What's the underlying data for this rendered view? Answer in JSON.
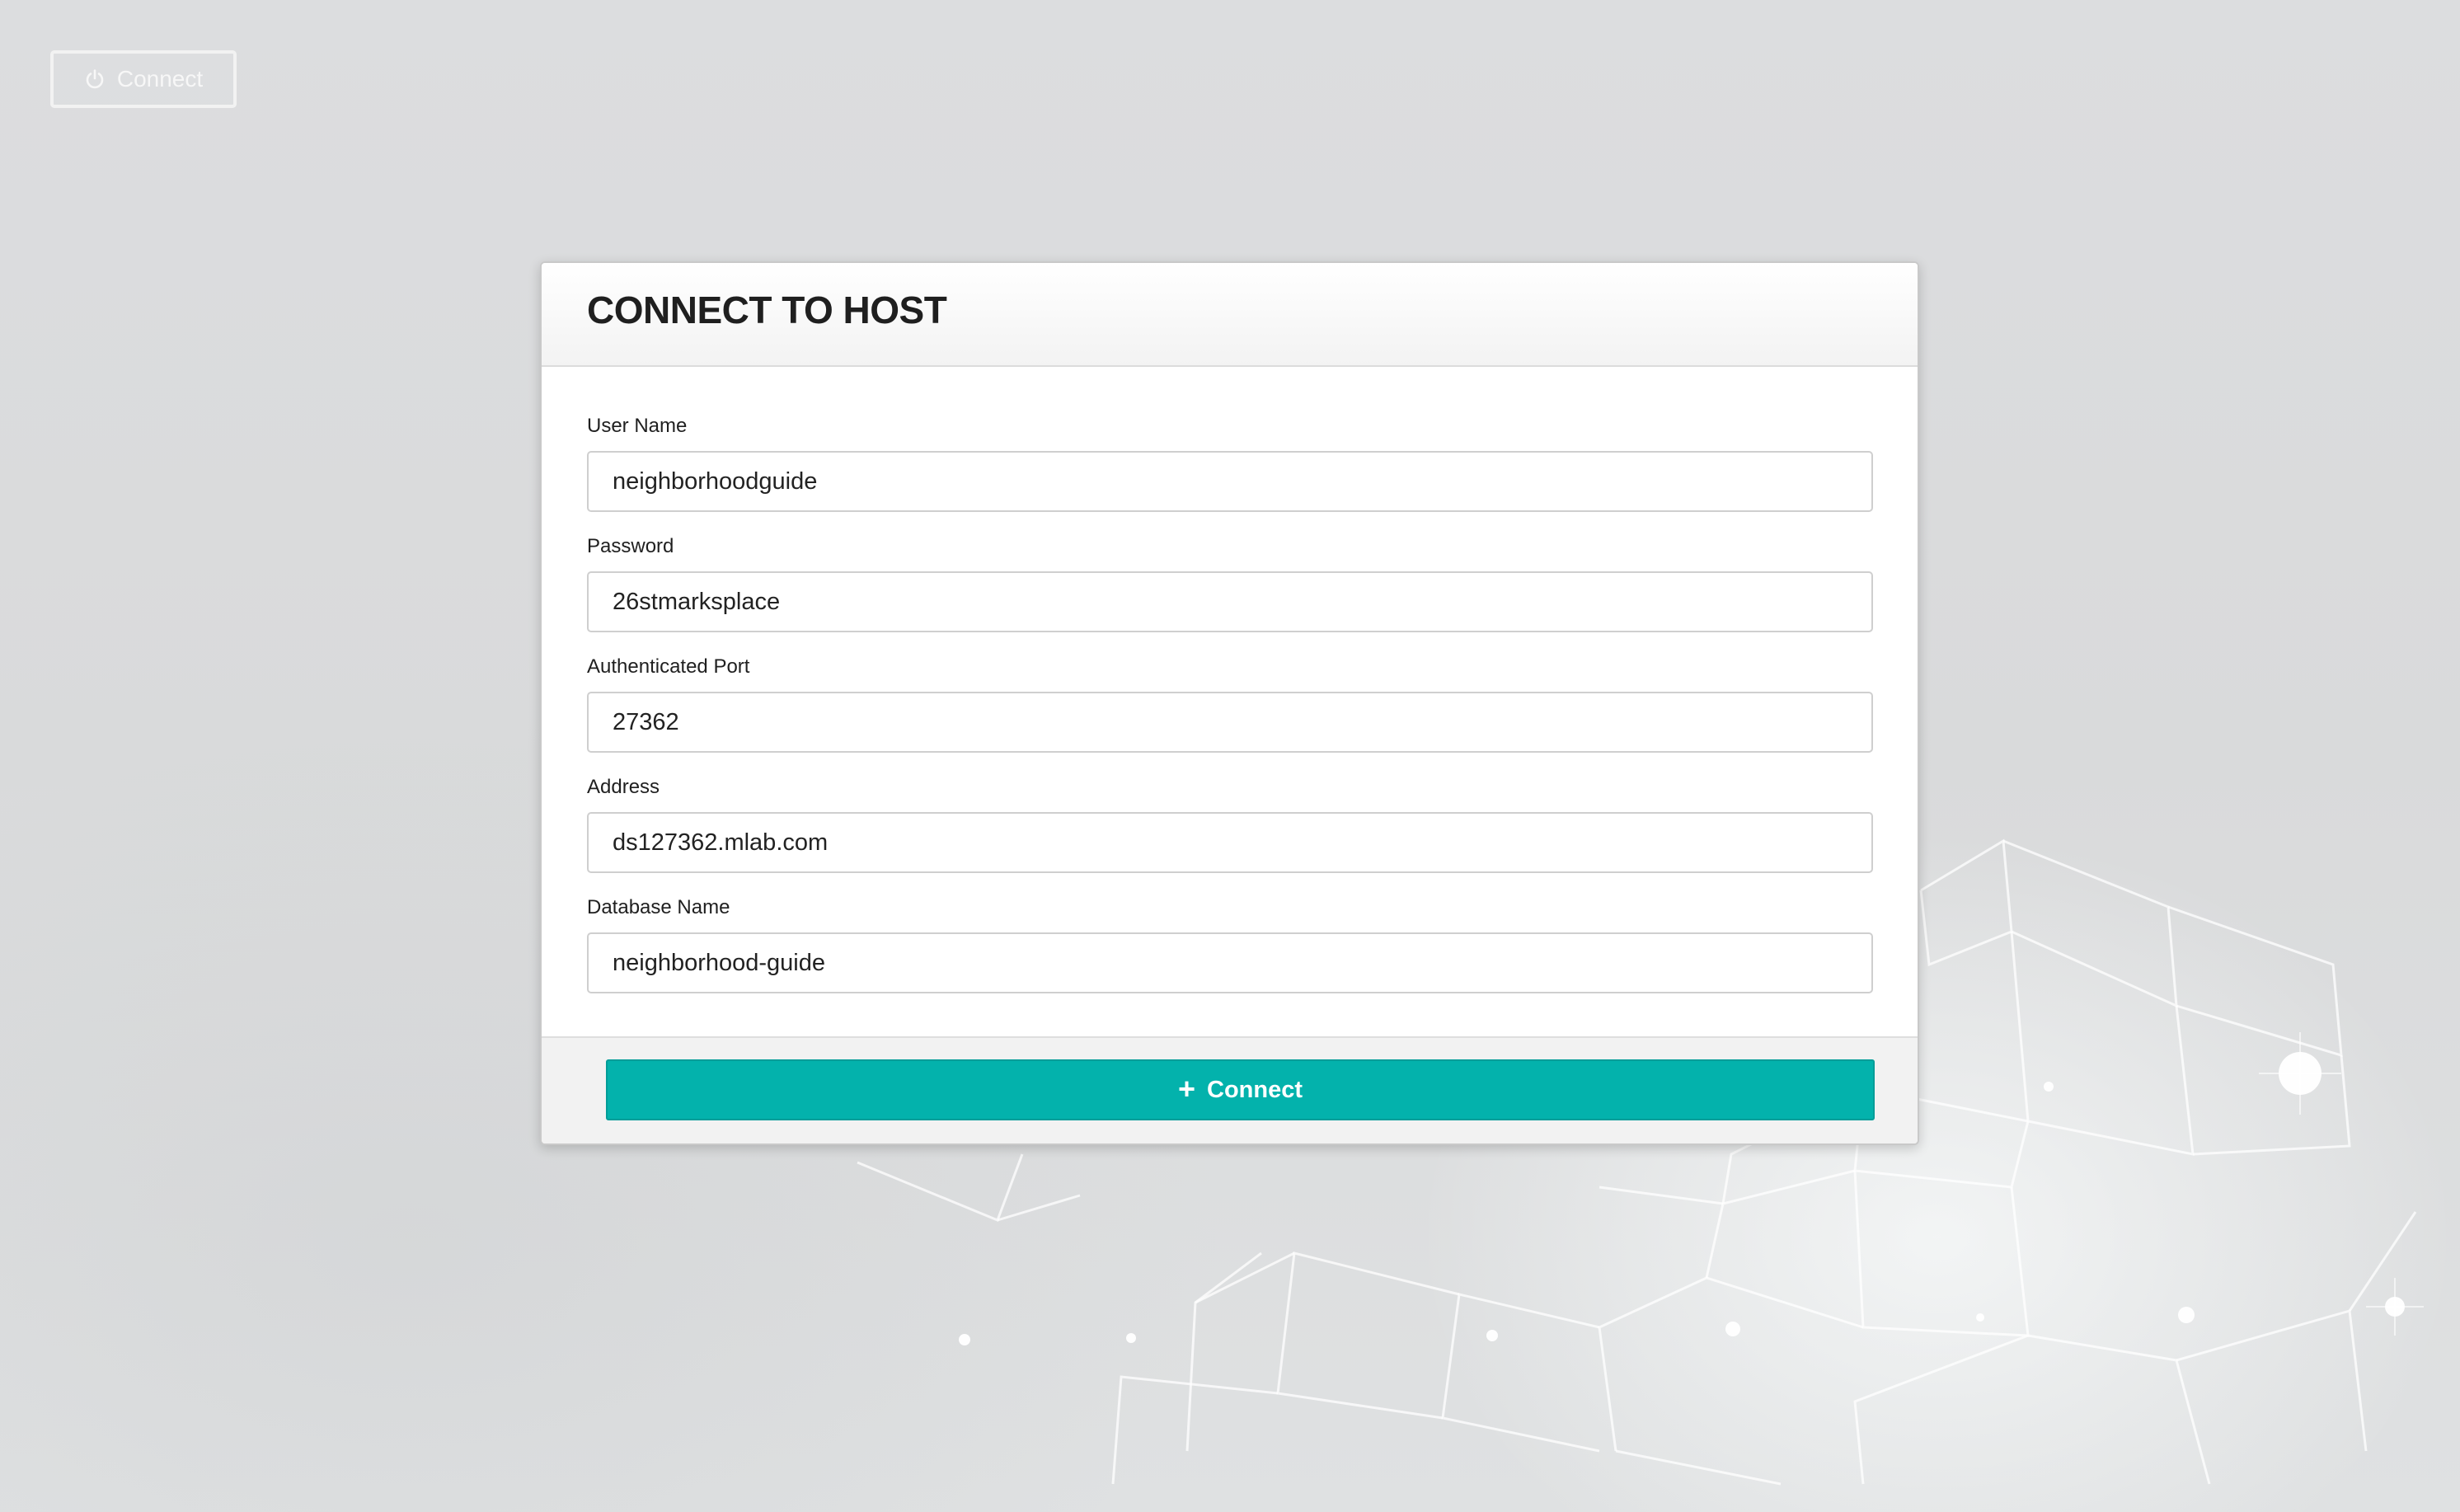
{
  "top_bar": {
    "connect_label": "Connect",
    "connect_icon": "power-icon"
  },
  "modal": {
    "title": "CONNECT TO HOST",
    "fields": [
      {
        "label": "User Name",
        "value": "neighborhoodguide"
      },
      {
        "label": "Password",
        "value": "26stmarksplace"
      },
      {
        "label": "Authenticated Port",
        "value": "27362"
      },
      {
        "label": "Address",
        "value": "ds127362.mlab.com"
      },
      {
        "label": "Database Name",
        "value": "neighborhood-guide"
      }
    ],
    "submit": {
      "label": "Connect",
      "icon": "plus-icon",
      "color": "#03b2ac"
    }
  }
}
